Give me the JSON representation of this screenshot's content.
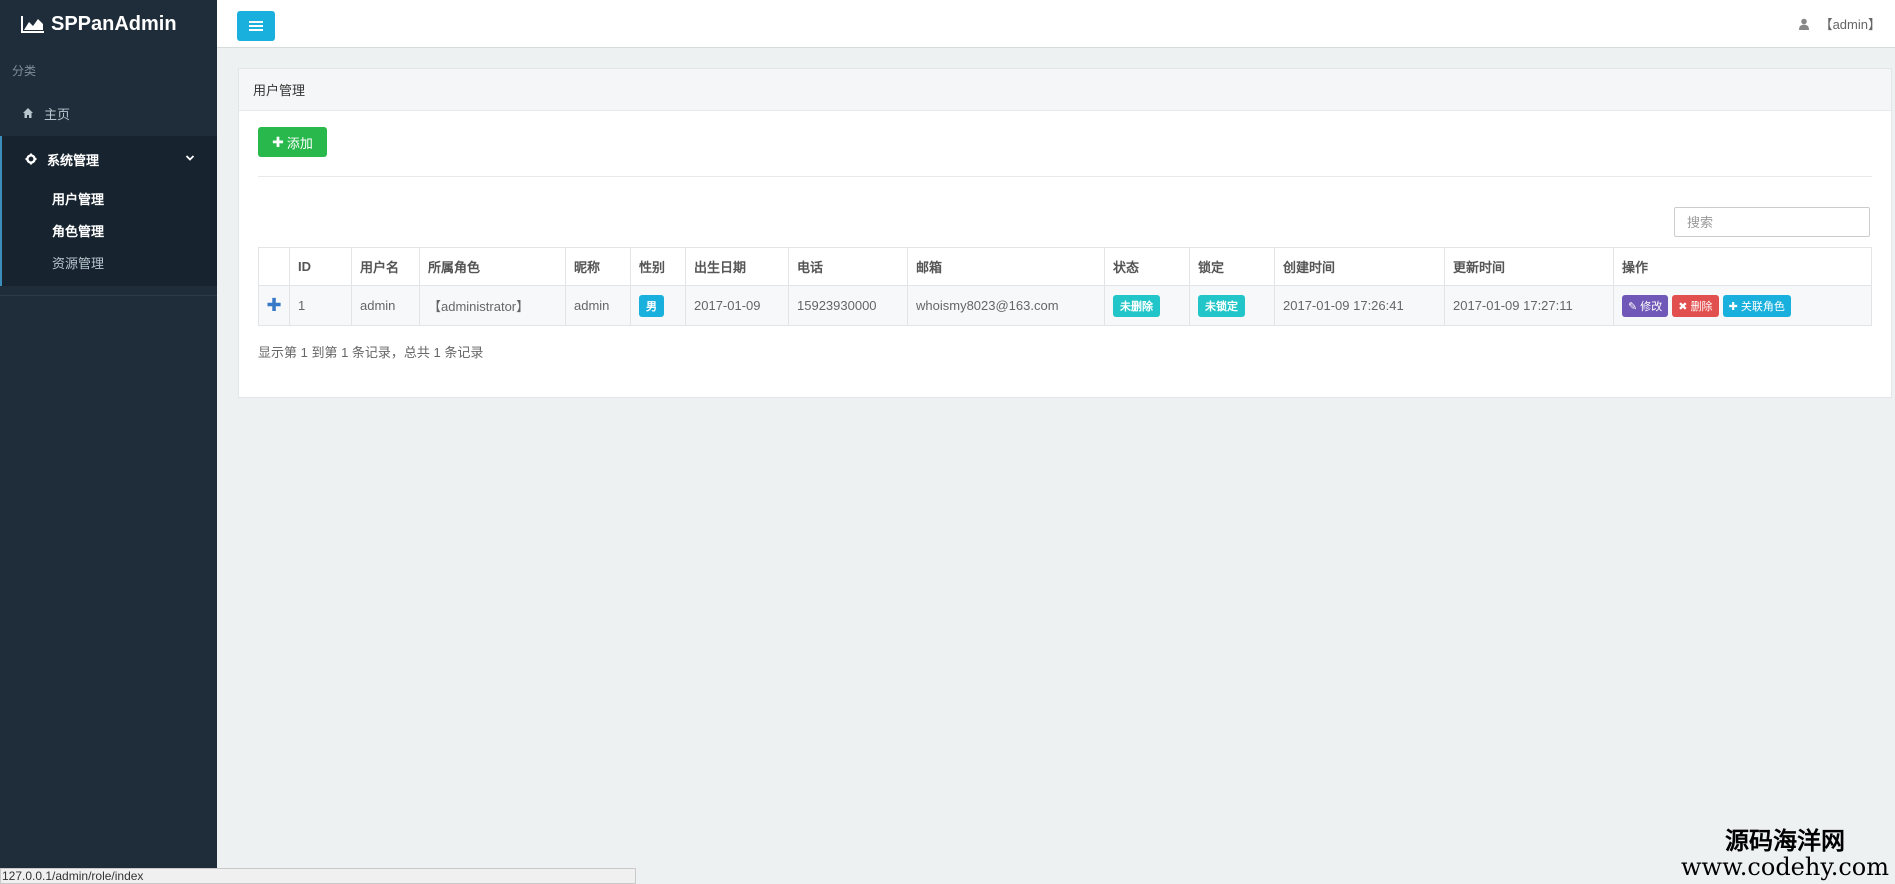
{
  "app": {
    "title": "SPPanAdmin"
  },
  "sidebar": {
    "header": "分类",
    "home_label": "主页",
    "group": {
      "label": "系统管理",
      "items": [
        {
          "label": "用户管理"
        },
        {
          "label": "角色管理"
        },
        {
          "label": "资源管理"
        }
      ]
    }
  },
  "topbar": {
    "user": "【admin】"
  },
  "panel": {
    "title": "用户管理",
    "add_label": "添加",
    "search_placeholder": "搜索",
    "columns": [
      "ID",
      "用户名",
      "所属角色",
      "昵称",
      "性别",
      "出生日期",
      "电话",
      "邮箱",
      "状态",
      "锁定",
      "创建时间",
      "更新时间",
      "操作"
    ],
    "rows": [
      {
        "id": "1",
        "username": "admin",
        "role": "【administrator】",
        "nickname": "admin",
        "sex": "男",
        "birthday": "2017-01-09",
        "phone": "15923930000",
        "email": "whoismy8023@163.com",
        "status": "未删除",
        "locked": "未锁定",
        "created": "2017-01-09 17:26:41",
        "updated": "2017-01-09 17:27:11",
        "actions": {
          "edit": "修改",
          "delete": "删除",
          "role": "关联角色"
        }
      }
    ],
    "footer": "显示第 1 到第 1 条记录，总共 1 条记录"
  },
  "status_bar": {
    "url": "127.0.0.1/admin/role/index"
  },
  "watermark": {
    "line1": "源码海洋网",
    "line2": "www.codehy.com"
  },
  "colors": {
    "sidebar": "#1f2d3b",
    "accent": "#1ab0de",
    "add": "#28b84b",
    "edit": "#6f58b7",
    "delete": "#e24f4f"
  }
}
